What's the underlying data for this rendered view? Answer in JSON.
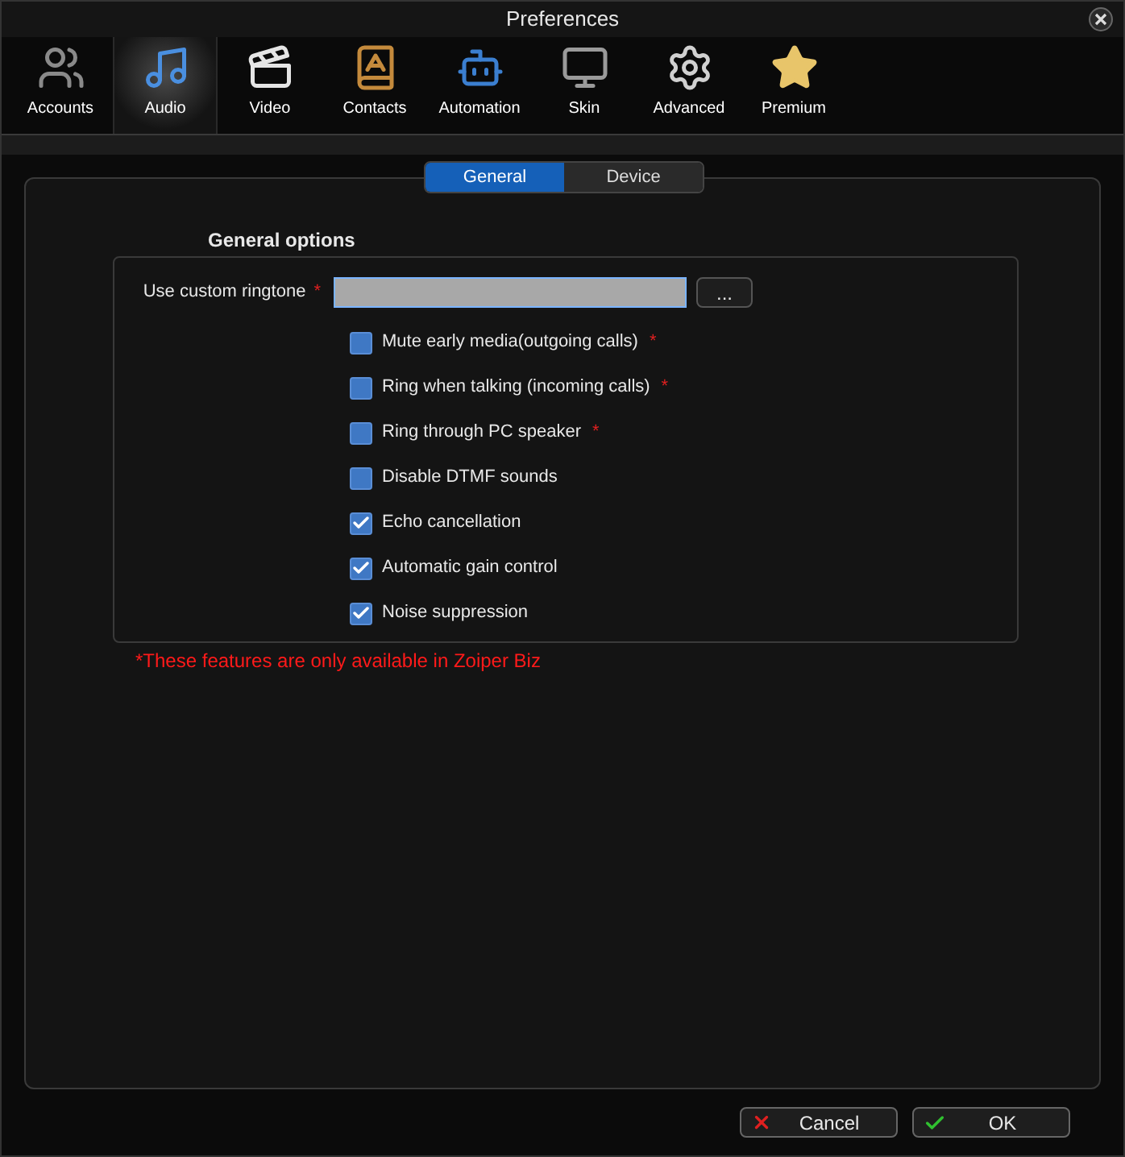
{
  "window": {
    "title": "Preferences"
  },
  "toolbar": [
    {
      "label": "Accounts",
      "selected": false
    },
    {
      "label": "Audio",
      "selected": true
    },
    {
      "label": "Video",
      "selected": false
    },
    {
      "label": "Contacts",
      "selected": false
    },
    {
      "label": "Automation",
      "selected": false
    },
    {
      "label": "Skin",
      "selected": false
    },
    {
      "label": "Advanced",
      "selected": false
    },
    {
      "label": "Premium",
      "selected": false
    }
  ],
  "tabs": [
    {
      "label": "General",
      "selected": true
    },
    {
      "label": "Device",
      "selected": false
    }
  ],
  "section_title": "General options",
  "ringtone": {
    "label": "Use custom ringtone",
    "marker": "*",
    "button": "..."
  },
  "options": [
    {
      "label": "Mute early media(outgoing calls)",
      "checked": false,
      "marker": "*"
    },
    {
      "label": "Ring when talking (incoming calls)",
      "checked": false,
      "marker": "*"
    },
    {
      "label": "Ring through PC speaker",
      "checked": false,
      "marker": "*"
    },
    {
      "label": "Disable DTMF sounds",
      "checked": false
    },
    {
      "label": "Echo cancellation",
      "checked": true
    },
    {
      "label": "Automatic gain control",
      "checked": true
    },
    {
      "label": "Noise suppression",
      "checked": true
    }
  ],
  "footnote": "*These features are only available in Zoiper Biz",
  "buttons": [
    {
      "label": "Cancel",
      "kind": "cancel"
    },
    {
      "label": "OK",
      "kind": "ok"
    }
  ]
}
